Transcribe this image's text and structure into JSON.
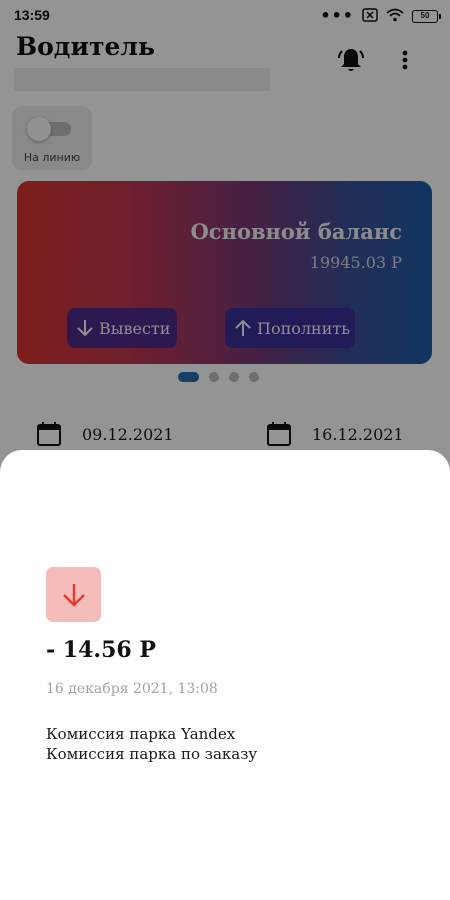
{
  "status_bar": {
    "time": "13:59",
    "more_indicator": "•••",
    "battery_level": "50",
    "icons": [
      "notification-dots-icon",
      "sim-blocked-icon",
      "wifi-icon",
      "battery-icon"
    ]
  },
  "header": {
    "title": "Водитель",
    "icons": [
      "bell-alert-icon",
      "more-vert-icon"
    ]
  },
  "online_toggle": {
    "label": "На линию",
    "state": "off"
  },
  "balance_card": {
    "title": "Основной баланс",
    "amount": "19945.03 Р",
    "withdraw_label": "Вывести",
    "topup_label": "Пополнить",
    "gradient": [
      "#d8352f",
      "#1f5ca7"
    ],
    "button_color": "#4b2b8a"
  },
  "pager": {
    "count": 4,
    "active_index": 0,
    "active_color": "#1f6fb4"
  },
  "date_filter": {
    "from": "09.12.2021",
    "to": "16.12.2021",
    "icon": "calendar-icon"
  },
  "transaction": {
    "icon": "arrow-down-icon",
    "icon_color": "#e53935",
    "icon_bg": "#f6bcb9",
    "amount": "- 14.56 Р",
    "date": "16 декабря 2021, 13:08",
    "description_line1": "Комиссия парка Yandex",
    "description_line2": "Комиссия парка по заказу"
  }
}
